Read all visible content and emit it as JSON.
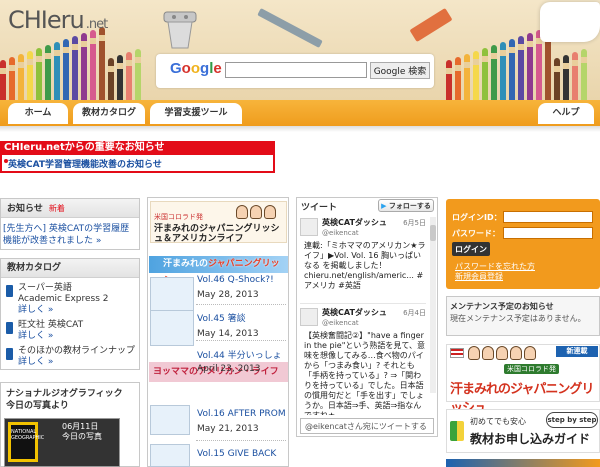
{
  "header": {
    "logo": "CHIeru",
    "logo_suffix": ".net",
    "google_label": "Google",
    "search_placeholder": "",
    "search_button": "Google 検索"
  },
  "nav": {
    "tabs": [
      "ホーム",
      "教材カタログ",
      "学習支援ツール"
    ],
    "help": "ヘルプ"
  },
  "notice": {
    "title": "CHIeru.netからの重要なお知らせ",
    "item": "英検CAT学習管理機能改善のお知らせ"
  },
  "news": {
    "heading": "お知らせ",
    "badge": "新着",
    "text": "[先生方へ] 英検CATの学習履歴機能が改善されました »"
  },
  "catalog": {
    "heading": "教材カタログ",
    "items": [
      {
        "name": "スーパー英語",
        "sub": "Academic Express 2",
        "link": "詳しく »"
      },
      {
        "name": "旺文社 英検CAT",
        "sub": "",
        "link": "詳しく »"
      },
      {
        "name": "そのほかの教材ラインナップ",
        "sub": "",
        "link": "詳しく »"
      }
    ]
  },
  "natgeo": {
    "title": "ナショナルジオグラフィック",
    "subtitle": "今日の写真より",
    "logo": "NATIONAL GEOGRAPHIC",
    "date": "06月11日",
    "date_sub": "今日の写真"
  },
  "column": {
    "tag": "米国コロラド発",
    "title": "汗まみれのジャパニングリッシュ＆アメリカンライフ",
    "series1": "汗まみれの",
    "series1_accent": "ジャパニングリッシュ",
    "episodes1": [
      {
        "title": "Vol.46 Q-Shock?!",
        "date": "May 28, 2013"
      },
      {
        "title": "Vol.45 箸談",
        "date": "May 14, 2013"
      },
      {
        "title": "Vol.44 半分いっしょ",
        "date": "April 23, 2013"
      }
    ],
    "series2": "ヨッママの",
    "series2_accent": "アメリカン・ライフ",
    "episodes2": [
      {
        "title": "Vol.16 AFTER PROM",
        "date": "May 21, 2013"
      },
      {
        "title": "Vol.15 GIVE BACK",
        "date": ""
      }
    ]
  },
  "twitter": {
    "heading": "ツイート",
    "follow": "フォローする",
    "tweets": [
      {
        "name": "英検CATダッシュ",
        "handle": "@eikencat",
        "date": "6月5日",
        "text": "連載:「ミホママのアメリカン★ライフ」▶Vol. Vol. 16 胸いっぱいなる を掲載しました！ chieru.net/english/americ... #アメリカ #英語"
      },
      {
        "name": "英検CATダッシュ",
        "handle": "@eikencat",
        "date": "6月4日",
        "text": "【英検奮闘記②】\"have a finger in the pie\"という熟語を見て、意味を想像してみる…食べ物のパイから「つまみ食い」? それとも「手柄を持っている」? ⇒「関わりを持っている」でした。日本語の慣用句だと「手を出す」でしょうか。日本語⇒手、英語⇒指なんですね★"
      }
    ],
    "input_placeholder": "@eikencatさん宛にツイートする"
  },
  "login": {
    "id_label": "ログインID：",
    "pw_label": "パスワード：",
    "button": "ログイン",
    "forgot": "パスワードを忘れた方",
    "register": "新規会員登録"
  },
  "maintenance": {
    "title": "メンテナンス予定のお知らせ",
    "text": "現在メンテナンス予定はありません。"
  },
  "banners": {
    "b1_tag": "新連載",
    "b1_sub": "米国コロラド発",
    "b1_title": "汗まみれのジャパニングリッシュ",
    "b2_a": "初めてでも安心",
    "b2_b": "教材お申し込みガイド",
    "b2_tag": "step by step"
  },
  "colors": {
    "brand_orange": "#f29a1d",
    "notice_red": "#e30c18",
    "link_blue": "#1a4fa0"
  }
}
